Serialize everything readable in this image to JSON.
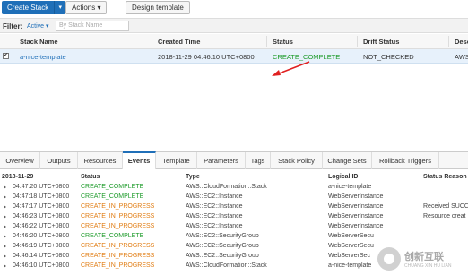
{
  "toolbar": {
    "create_stack": "Create Stack",
    "actions": "Actions",
    "design_template": "Design template"
  },
  "filter": {
    "label": "Filter:",
    "status_value": "Active",
    "search_placeholder": "By Stack Name"
  },
  "stack_table": {
    "headers": [
      "Stack Name",
      "Created Time",
      "Status",
      "Drift Status",
      "Desc"
    ],
    "row": {
      "name": "a-nice-template",
      "created": "2018-11-29 04:46:10 UTC+0800",
      "status": "CREATE_COMPLETE",
      "drift": "NOT_CHECKED",
      "desc": "AWS"
    }
  },
  "tabs": [
    "Overview",
    "Outputs",
    "Resources",
    "Events",
    "Template",
    "Parameters",
    "Tags",
    "Stack Policy",
    "Change Sets",
    "Rollback Triggers"
  ],
  "active_tab": "Events",
  "events": {
    "date": "2018-11-29",
    "headers": [
      "Status",
      "Type",
      "Logical ID",
      "Status Reason"
    ],
    "rows": [
      {
        "time": "04:47:20 UTC+0800",
        "status": "CREATE_COMPLETE",
        "type": "AWS::CloudFormation::Stack",
        "logical": "a-nice-template",
        "reason": ""
      },
      {
        "time": "04:47:18 UTC+0800",
        "status": "CREATE_COMPLETE",
        "type": "AWS::EC2::Instance",
        "logical": "WebServerInstance",
        "reason": ""
      },
      {
        "time": "04:47:17 UTC+0800",
        "status": "CREATE_IN_PROGRESS",
        "type": "AWS::EC2::Instance",
        "logical": "WebServerInstance",
        "reason": "Received SUCC"
      },
      {
        "time": "04:46:23 UTC+0800",
        "status": "CREATE_IN_PROGRESS",
        "type": "AWS::EC2::Instance",
        "logical": "WebServerInstance",
        "reason": "Resource creat"
      },
      {
        "time": "04:46:22 UTC+0800",
        "status": "CREATE_IN_PROGRESS",
        "type": "AWS::EC2::Instance",
        "logical": "WebServerInstance",
        "reason": ""
      },
      {
        "time": "04:46:20 UTC+0800",
        "status": "CREATE_COMPLETE",
        "type": "AWS::EC2::SecurityGroup",
        "logical": "WebServerSecu",
        "reason": ""
      },
      {
        "time": "04:46:19 UTC+0800",
        "status": "CREATE_IN_PROGRESS",
        "type": "AWS::EC2::SecurityGroup",
        "logical": "WebServerSecu",
        "reason": ""
      },
      {
        "time": "04:46:14 UTC+0800",
        "status": "CREATE_IN_PROGRESS",
        "type": "AWS::EC2::SecurityGroup",
        "logical": "WebServerSec",
        "reason": ""
      },
      {
        "time": "04:46:10 UTC+0800",
        "status": "CREATE_IN_PROGRESS",
        "type": "AWS::CloudFormation::Stack",
        "logical": "a-nice-template",
        "reason": ""
      }
    ]
  },
  "watermark": {
    "title": "创新互联",
    "sub": "CHUANG XIN HU LIAN"
  },
  "colors": {
    "primary": "#1f6fb8",
    "complete": "#1d9b2a",
    "in_progress": "#e07b10",
    "arrow": "#e02020"
  }
}
